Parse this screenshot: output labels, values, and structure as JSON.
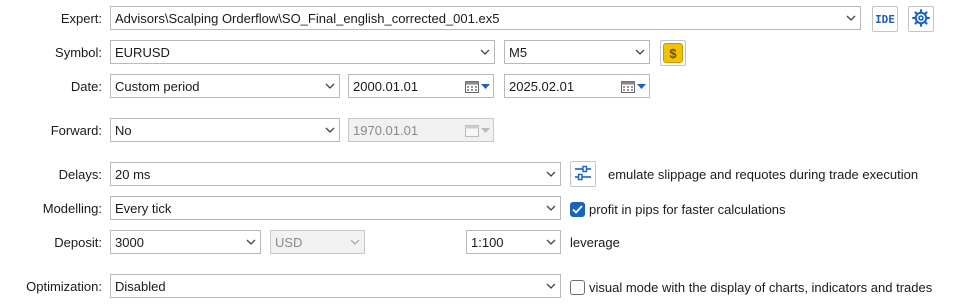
{
  "labels": {
    "expert": "Expert:",
    "symbol": "Symbol:",
    "date": "Date:",
    "forward": "Forward:",
    "delays": "Delays:",
    "modelling": "Modelling:",
    "deposit": "Deposit:",
    "optimization": "Optimization:"
  },
  "expert": {
    "value": "Advisors\\Scalping Orderflow\\SO_Final_english_corrected_001.ex5",
    "ide_label": "IDE"
  },
  "symbol": {
    "value": "EURUSD",
    "timeframe": "M5",
    "coin_glyph": "$"
  },
  "date": {
    "period": "Custom period",
    "from": "2000.01.01",
    "to": "2025.02.01"
  },
  "forward": {
    "value": "No",
    "date": "1970.01.01"
  },
  "delays": {
    "value": "20 ms",
    "note": "emulate slippage and requotes during trade execution"
  },
  "modelling": {
    "value": "Every tick",
    "checkbox_label": "profit in pips for faster calculations",
    "checked": true
  },
  "deposit": {
    "value": "3000",
    "currency": "USD",
    "leverage_value": "1:100",
    "leverage_label": "leverage"
  },
  "optimization": {
    "value": "Disabled",
    "checkbox_label": "visual mode with the display of charts, indicators and trades",
    "checked": false
  },
  "icons": {
    "chevron": "chevron-down-icon",
    "settings": "gear-icon",
    "calendar": "calendar-icon",
    "sliders": "sliders-icon",
    "check": "checkmark-icon"
  },
  "colors": {
    "accent": "#1764c0",
    "coin": "#f2c200"
  }
}
